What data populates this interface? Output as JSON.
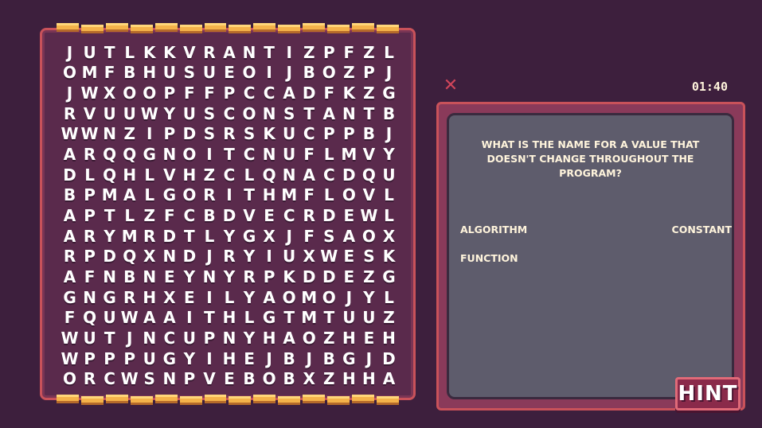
{
  "grid": {
    "rows": [
      "JUTLKKVRANTIZPFZL",
      "OMFBHUSUEOIJBOZPJ",
      "JWXOOPFFPCCADFKZG",
      "RVUUWYUSCONSTANTB",
      "WWNZIPDSRSKUCPPBJ",
      "ARQQGNOITCNUFLMVY",
      "DLQHLVHZCLQNACDQU",
      "BPMALGORITHMFLOVL",
      "APTLZFCBDVECRDEWL",
      "ARYMRDTLYGXJFSAOX",
      "RPDQXNDJRYIUXWESK",
      "AFNBNEYNYRPKDDEZG",
      "GNGRHXEILYAOMOJYL",
      "FQUWAAITHLGTMTUUZ",
      "WUTJNCUPNYHAOZHEH",
      "WPPPUGYIHEJBJBGJD",
      "ORCWSNPVEBOBXZHHA"
    ]
  },
  "timer": "01:40",
  "close_label": "✕",
  "question": "What is the name for a value that doesn't change throughout the program?",
  "answers": [
    "ALGORITHM",
    "CONSTANT",
    "FUNCTION"
  ],
  "hint_label": "HINT",
  "colors": {
    "background": "#3d1f3d",
    "board": "#5a2a4c",
    "frame": "#c9525a",
    "rail": "#f4b24a",
    "panel_inner": "#5e5c6c",
    "text": "#fff4dc"
  }
}
